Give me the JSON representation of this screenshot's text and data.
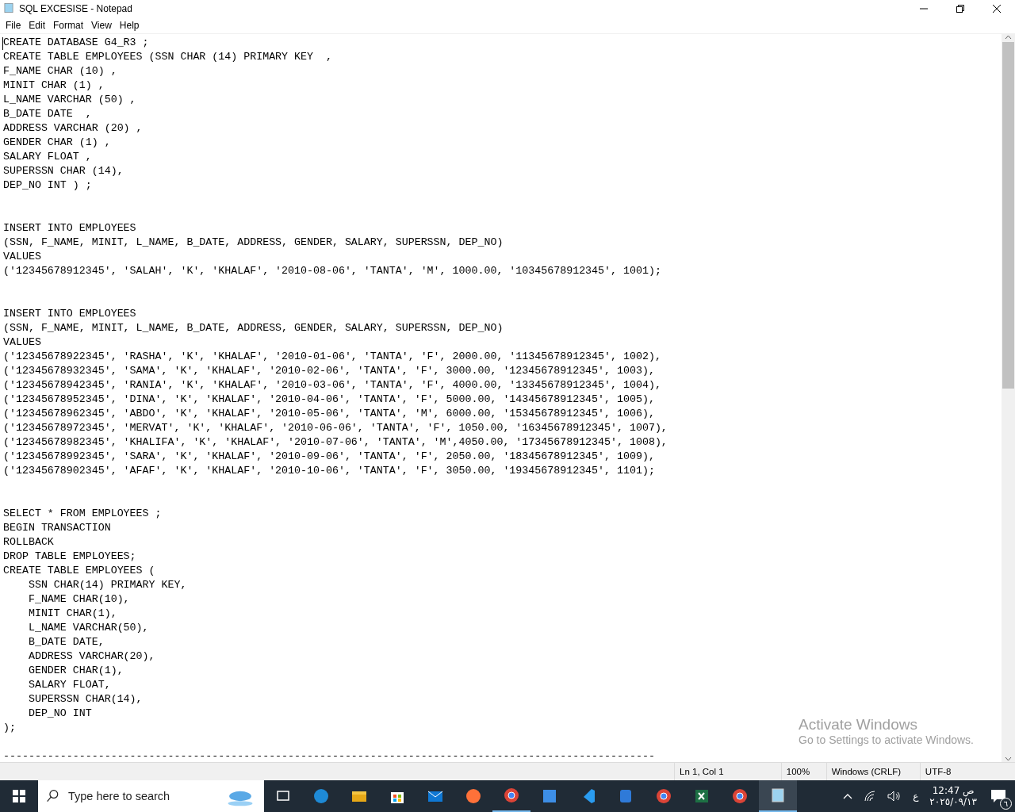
{
  "window": {
    "title": "SQL EXCESISE - Notepad"
  },
  "menu": [
    "File",
    "Edit",
    "Format",
    "View",
    "Help"
  ],
  "editor": {
    "lines": [
      {
        "kind": "code",
        "text": "CREATE DATABASE G4_R3 ;"
      },
      {
        "kind": "code",
        "text": "CREATE TABLE EMPLOYEES (SSN CHAR (14) PRIMARY KEY  ,"
      },
      {
        "kind": "code",
        "text": "F_NAME CHAR (10) ,"
      },
      {
        "kind": "code",
        "text": "MINIT CHAR (1) ,"
      },
      {
        "kind": "code",
        "text": "L_NAME VARCHAR (50) ,"
      },
      {
        "kind": "code",
        "text": "B_DATE DATE  ,"
      },
      {
        "kind": "code",
        "text": "ADDRESS VARCHAR (20) ,"
      },
      {
        "kind": "code",
        "text": "GENDER CHAR (1) ,"
      },
      {
        "kind": "code",
        "text": "SALARY FLOAT ,"
      },
      {
        "kind": "code",
        "text": "SUPERSSN CHAR (14),"
      },
      {
        "kind": "code",
        "text": "DEP_NO INT ) ;"
      },
      {
        "kind": "blank"
      },
      {
        "kind": "blank"
      },
      {
        "kind": "code",
        "text": "INSERT INTO EMPLOYEES"
      },
      {
        "kind": "code",
        "text": "(SSN, F_NAME, MINIT, L_NAME, B_DATE, ADDRESS, GENDER, SALARY, SUPERSSN, DEP_NO)"
      },
      {
        "kind": "code",
        "text": "VALUES"
      },
      {
        "kind": "code",
        "text": "('12345678912345', 'SALAH', 'K', 'KHALAF', '2010-08-06', 'TANTA', 'M', 1000.00, '10345678912345', 1001);"
      },
      {
        "kind": "blank"
      },
      {
        "kind": "blank"
      },
      {
        "kind": "code",
        "text": "INSERT INTO EMPLOYEES"
      },
      {
        "kind": "code",
        "text": "(SSN, F_NAME, MINIT, L_NAME, B_DATE, ADDRESS, GENDER, SALARY, SUPERSSN, DEP_NO)"
      },
      {
        "kind": "code",
        "text": "VALUES"
      },
      {
        "kind": "code",
        "text": "('12345678922345', 'RASHA', 'K', 'KHALAF', '2010-01-06', 'TANTA', 'F', 2000.00, '11345678912345', 1002),"
      },
      {
        "kind": "code",
        "text": "('12345678932345', 'SAMA', 'K', 'KHALAF', '2010-02-06', 'TANTA', 'F', 3000.00, '12345678912345', 1003),"
      },
      {
        "kind": "code",
        "text": "('12345678942345', 'RANIA', 'K', 'KHALAF', '2010-03-06', 'TANTA', 'F', 4000.00, '13345678912345', 1004),"
      },
      {
        "kind": "code",
        "text": "('12345678952345', 'DINA', 'K', 'KHALAF', '2010-04-06', 'TANTA', 'F', 5000.00, '14345678912345', 1005),"
      },
      {
        "kind": "code",
        "text": "('12345678962345', 'ABDO', 'K', 'KHALAF', '2010-05-06', 'TANTA', 'M', 6000.00, '15345678912345', 1006),"
      },
      {
        "kind": "code",
        "text": "('12345678972345', 'MERVAT', 'K', 'KHALAF', '2010-06-06', 'TANTA', 'F', 1050.00, '16345678912345', 1007),"
      },
      {
        "kind": "code",
        "text": "('12345678982345', 'KHALIFA', 'K', 'KHALAF', '2010-07-06', 'TANTA', 'M',4050.00, '17345678912345', 1008),"
      },
      {
        "kind": "code",
        "text": "('12345678992345', 'SARA', 'K', 'KHALAF', '2010-09-06', 'TANTA', 'F', 2050.00, '18345678912345', 1009),"
      },
      {
        "kind": "code",
        "text": "('12345678902345', 'AFAF', 'K', 'KHALAF', '2010-10-06', 'TANTA', 'F', 3050.00, '19345678912345', 1101);"
      },
      {
        "kind": "blank"
      },
      {
        "kind": "blank"
      },
      {
        "kind": "code",
        "text": "SELECT * FROM EMPLOYEES ;"
      },
      {
        "kind": "code",
        "text": "BEGIN TRANSACTION"
      },
      {
        "kind": "code",
        "text": "ROLLBACK"
      },
      {
        "kind": "code",
        "text": "DROP TABLE EMPLOYEES;"
      },
      {
        "kind": "code",
        "text": "CREATE TABLE EMPLOYEES ("
      },
      {
        "kind": "code",
        "text": "    SSN CHAR(14) PRIMARY KEY,"
      },
      {
        "kind": "code",
        "text": "    F_NAME CHAR(10),"
      },
      {
        "kind": "code",
        "text": "    MINIT CHAR(1),"
      },
      {
        "kind": "code",
        "text": "    L_NAME VARCHAR(50),"
      },
      {
        "kind": "code",
        "text": "    B_DATE DATE,"
      },
      {
        "kind": "code",
        "text": "    ADDRESS VARCHAR(20),"
      },
      {
        "kind": "code",
        "text": "    GENDER CHAR(1),"
      },
      {
        "kind": "code",
        "text": "    SALARY FLOAT,"
      },
      {
        "kind": "code",
        "text": "    SUPERSSN CHAR(14),"
      },
      {
        "kind": "code",
        "text": "    DEP_NO INT"
      },
      {
        "kind": "code",
        "text": ");"
      },
      {
        "kind": "blank"
      },
      {
        "kind": "code",
        "text": "-------------------------------------------------------------------------------------------------------"
      }
    ]
  },
  "activation": {
    "title": "Activate Windows",
    "message": "Go to Settings to activate Windows."
  },
  "status_bar": [
    "Ln 1, Col 1",
    "100%",
    "Windows (CRLF)",
    "UTF-8"
  ],
  "taskbar": {
    "search_placeholder": "Type here to search",
    "language": "ع",
    "time": "12:47 ص",
    "date": "٢٠٢٥/٠٩/١٣",
    "notification_count": "٦"
  }
}
